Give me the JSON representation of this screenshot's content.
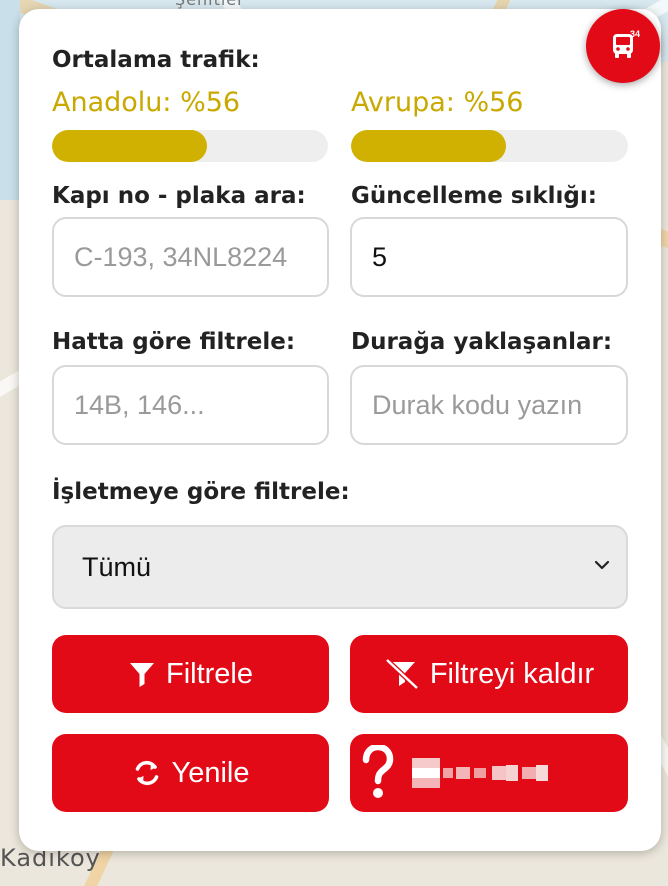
{
  "map": {
    "top_label": "Şehitler",
    "bottom_label": "Kadıköy"
  },
  "fab": {
    "icon": "bus-icon",
    "count": "34"
  },
  "traffic": {
    "title": "Ortalama trafik:",
    "anadolu": {
      "label": "Anadolu: %56",
      "percent": 56
    },
    "avrupa": {
      "label": "Avrupa: %56",
      "percent": 56
    },
    "bar_color": "#d0b000"
  },
  "fields": {
    "plate_search": {
      "label": "Kapı no - plaka ara:",
      "placeholder": "C-193, 34NL8224",
      "value": ""
    },
    "refresh_rate": {
      "label": "Güncelleme sıklığı:",
      "value": "5"
    },
    "line_filter": {
      "label": "Hatta göre filtrele:",
      "placeholder": "14B, 146...",
      "value": ""
    },
    "stop_approach": {
      "label": "Durağa yaklaşanlar:",
      "placeholder": "Durak kodu yazın",
      "value": ""
    },
    "operator_filter": {
      "label": "İşletmeye göre filtrele:",
      "selected": "Tümü"
    }
  },
  "buttons": {
    "filter": "Filtrele",
    "clear_filter": "Filtreyi kaldır",
    "refresh": "Yenile"
  },
  "colors": {
    "accent": "#e30a17",
    "traffic": "#c9a800"
  }
}
